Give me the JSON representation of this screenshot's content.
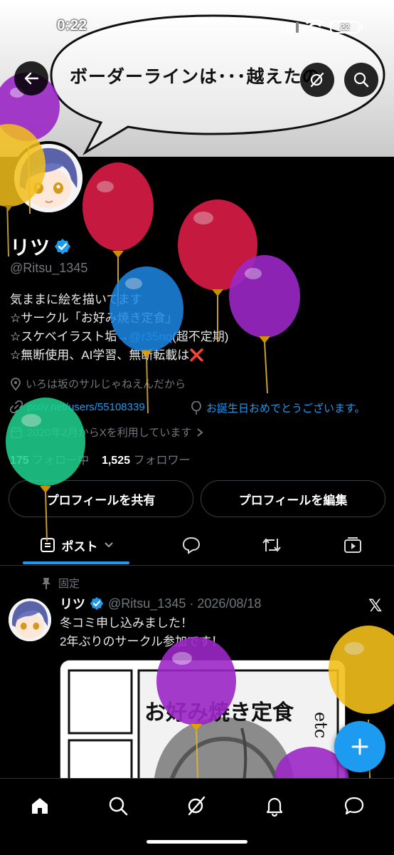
{
  "status_bar": {
    "time": "0:22",
    "battery": "22"
  },
  "banner": {
    "speech_text": "ボーダーラインは･･･越えたの"
  },
  "header": {
    "back_icon": "arrow-left-icon",
    "grok_icon": "grok-icon",
    "search_icon": "search-icon"
  },
  "profile": {
    "display_name": "リツ",
    "handle": "@Ritsu_1345",
    "bio": {
      "line1": "気ままに絵を描いてます",
      "line2": "☆サークル「お好み焼き定食」",
      "line3_prefix": "☆スケベイラスト垢→",
      "line3_link": "@r35nq",
      "line3_suffix": "(超不定期)",
      "line4": "☆無断使用、AI学習、無断転載は❌"
    },
    "location": "いろは坂のサルじゃねえんだから",
    "website": "pixiv.net/users/55108339",
    "birthday": "お誕生日おめでとうございます。",
    "joined": "2020年2月からXを利用しています",
    "following_count": "175",
    "following_label": "フォロー中",
    "followers_count": "1,525",
    "followers_label": "フォロワー",
    "share_button": "プロフィールを共有",
    "edit_button": "プロフィールを編集"
  },
  "tabs": {
    "posts": "ポスト"
  },
  "post": {
    "pinned_label": "固定",
    "name": "リツ",
    "handle_date": "@Ritsu_1345 · 2026/08/18",
    "text": "冬コミ申し込みました！\n2年ぶりのサークル参加です！",
    "image_title": "お好み焼き定食",
    "image_side_text": "etc"
  },
  "colors": {
    "accent": "#1d9bf0",
    "background": "#000000",
    "muted": "#71767b"
  }
}
